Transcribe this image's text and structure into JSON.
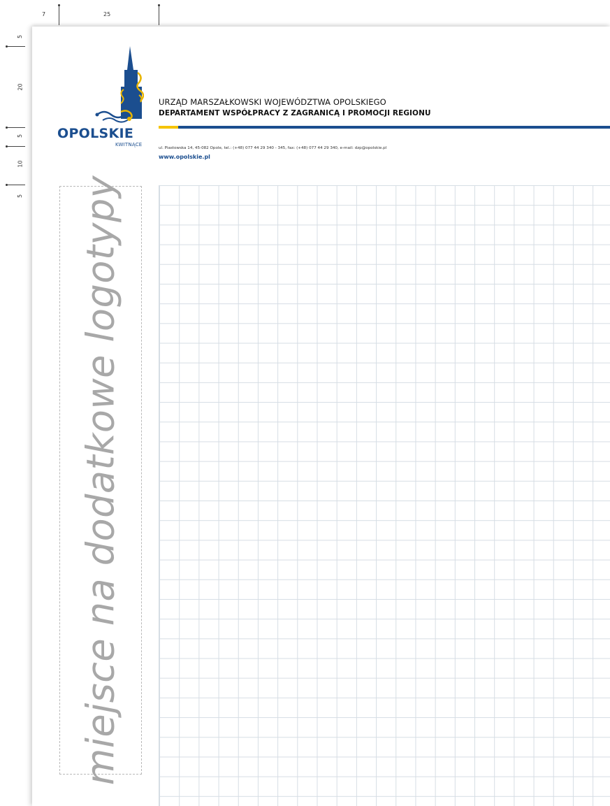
{
  "rulers": {
    "top": [
      "7",
      "25"
    ],
    "left": [
      "5",
      "20",
      "5",
      "10",
      "5"
    ]
  },
  "logo": {
    "word": "OPOLSKIE",
    "tagline": "KWITNĄCE",
    "colors": {
      "blue": "#1b4e8f",
      "gold": "#e8b400"
    }
  },
  "header": {
    "organization": "URZĄD MARSZAŁKOWSKI WOJEWÓDZTWA OPOLSKIEGO",
    "department": "DEPARTAMENT WSPÓŁPRACY Z ZAGRANICĄ I PROMOCJI REGIONU",
    "address": "ul. Piastowska 14, 45-082 Opole, tel.: (+48) 077 44 29 340 - 345, fax: (+48) 077 44 29 340, e-mail: dzp@opolskie.pl",
    "website": "www.opolskie.pl",
    "accent_colors": {
      "rule": "#1b4e8f",
      "marker": "#f5c400"
    }
  },
  "placeholder": {
    "text": "miejsce na dodatkowe logotypy"
  }
}
